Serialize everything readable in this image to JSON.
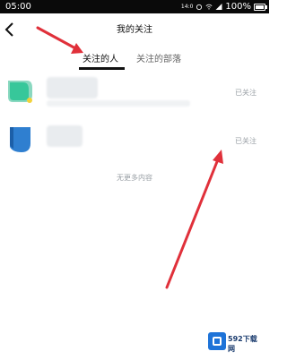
{
  "status_bar": {
    "time": "05:00",
    "network_small": "14:0",
    "battery_percent": "100%"
  },
  "header": {
    "title": "我的关注"
  },
  "tabs": [
    {
      "label": "关注的人",
      "active": true
    },
    {
      "label": "关注的部落",
      "active": false
    }
  ],
  "list": [
    {
      "follow_label": "已关注",
      "avatar_color": "#37c79a"
    },
    {
      "follow_label": "已关注",
      "avatar_color": "#2f7fd0"
    }
  ],
  "footer_text": "无更多内容",
  "watermark": {
    "text": "592下载网"
  },
  "colors": {
    "annotation_arrow": "#e0303a",
    "tab_active": "#111111",
    "muted_text": "#9aa0a6"
  }
}
